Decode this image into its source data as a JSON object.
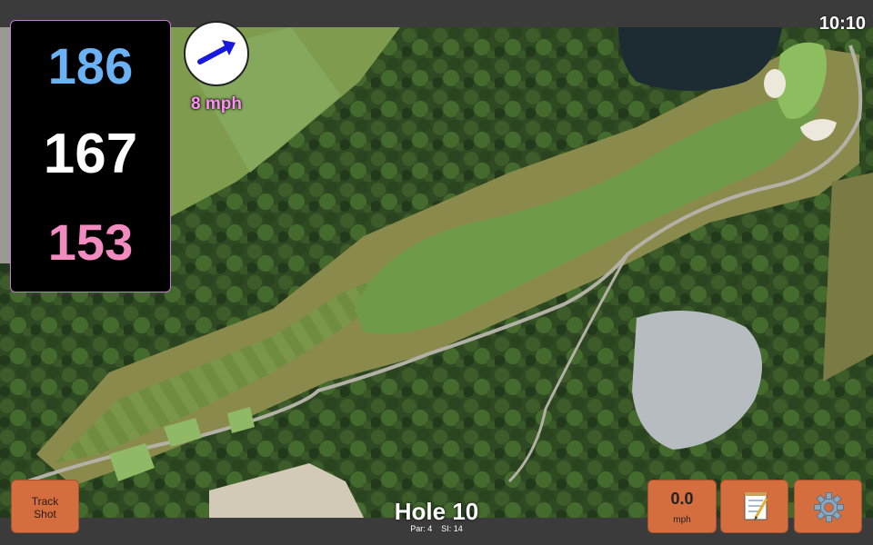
{
  "status": {
    "time": "10:10"
  },
  "yardages": {
    "back": "186",
    "middle": "167",
    "front": "153"
  },
  "wind": {
    "speed": "8 mph",
    "direction": "east-northeast",
    "arrow_color": "#1a1adf",
    "icon": "wind-direction-arrow-icon"
  },
  "hole": {
    "title": "Hole 10",
    "par": "Par: 4",
    "si": "SI: 14"
  },
  "buttons": {
    "track_shot": [
      "Track",
      "Shot"
    ],
    "speed_value": "0.0",
    "speed_unit": "mph",
    "notes_icon": "notepad-icon",
    "settings_icon": "gear-icon"
  },
  "colors": {
    "back": "#6ab2f3",
    "middle": "#ffffff",
    "front": "#f28cc0",
    "button": "#d56e3f",
    "wind_text": "#ff8ff4"
  }
}
